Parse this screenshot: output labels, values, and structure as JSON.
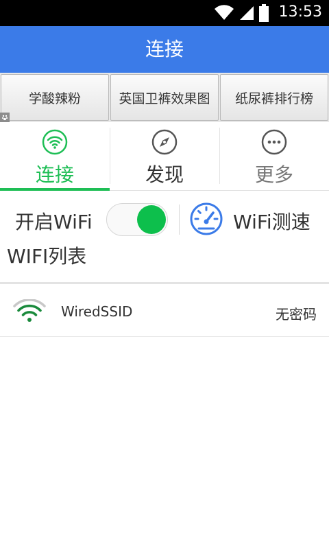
{
  "status_bar": {
    "time": "13:53"
  },
  "app_bar": {
    "title": "连接"
  },
  "ads": {
    "items": [
      "学酸辣粉",
      "英国卫裤效果图",
      "纸尿裤排行榜"
    ]
  },
  "tabs": [
    {
      "label": "连接",
      "icon": "wifi-icon",
      "active": true
    },
    {
      "label": "发现",
      "icon": "compass-icon",
      "active": false
    },
    {
      "label": "更多",
      "icon": "more-dots-icon",
      "active": false
    }
  ],
  "wifi_controls": {
    "open_label": "开启WiFi",
    "switch_on": true,
    "speed_test_label": "WiFi测速"
  },
  "wifi_list": {
    "title": "WIFI列表",
    "networks": [
      {
        "ssid": "WiredSSID",
        "security": "无密码"
      }
    ]
  },
  "colors": {
    "accent_blue": "#3b7be8",
    "accent_green": "#1ebe55",
    "switch_green": "#0dbf4c"
  }
}
